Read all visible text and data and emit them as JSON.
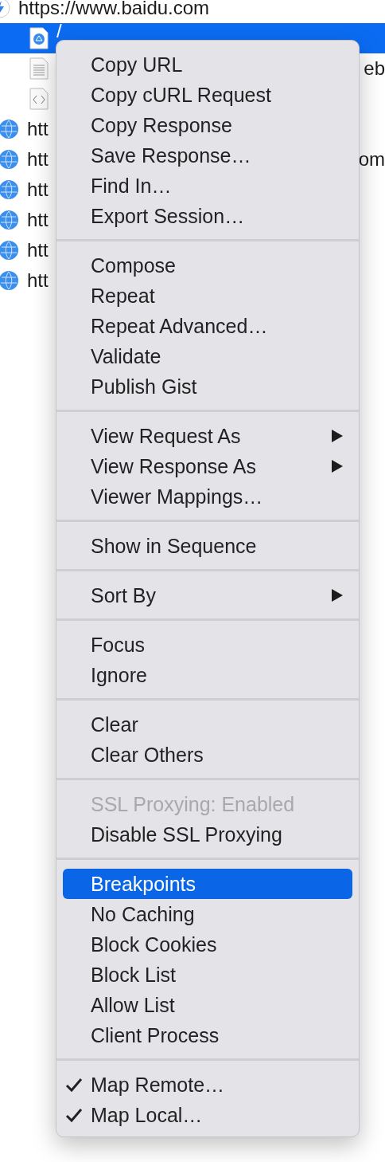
{
  "tree": [
    {
      "kind": "host",
      "label": "https://www.baidu.com",
      "selected": false,
      "children": [
        {
          "kind": "page",
          "label": "/",
          "selected": true
        },
        {
          "kind": "document",
          "trailing": "eb",
          "selected": false
        },
        {
          "kind": "code",
          "selected": false
        }
      ]
    },
    {
      "kind": "globe",
      "label": "htt",
      "selected": false
    },
    {
      "kind": "globe",
      "label": "htt",
      "trailing": "om",
      "selected": false
    },
    {
      "kind": "globe",
      "label": "htt",
      "selected": false
    },
    {
      "kind": "globe",
      "label": "htt",
      "selected": false
    },
    {
      "kind": "globe",
      "label": "htt",
      "selected": false
    },
    {
      "kind": "globe",
      "label": "htt",
      "selected": false
    }
  ],
  "context_menu": {
    "groups": [
      {
        "items": [
          {
            "label": "Copy URL",
            "selected": false,
            "disabled": false,
            "checked": false,
            "submenu": false
          },
          {
            "label": "Copy cURL Request",
            "selected": false,
            "disabled": false,
            "checked": false,
            "submenu": false
          },
          {
            "label": "Copy Response",
            "selected": false,
            "disabled": false,
            "checked": false,
            "submenu": false
          },
          {
            "label": "Save Response…",
            "selected": false,
            "disabled": false,
            "checked": false,
            "submenu": false
          },
          {
            "label": "Find In…",
            "selected": false,
            "disabled": false,
            "checked": false,
            "submenu": false
          },
          {
            "label": "Export Session…",
            "selected": false,
            "disabled": false,
            "checked": false,
            "submenu": false
          }
        ]
      },
      {
        "items": [
          {
            "label": "Compose",
            "selected": false,
            "disabled": false,
            "checked": false,
            "submenu": false
          },
          {
            "label": "Repeat",
            "selected": false,
            "disabled": false,
            "checked": false,
            "submenu": false
          },
          {
            "label": "Repeat Advanced…",
            "selected": false,
            "disabled": false,
            "checked": false,
            "submenu": false
          },
          {
            "label": "Validate",
            "selected": false,
            "disabled": false,
            "checked": false,
            "submenu": false
          },
          {
            "label": "Publish Gist",
            "selected": false,
            "disabled": false,
            "checked": false,
            "submenu": false
          }
        ]
      },
      {
        "items": [
          {
            "label": "View Request As",
            "selected": false,
            "disabled": false,
            "checked": false,
            "submenu": true
          },
          {
            "label": "View Response As",
            "selected": false,
            "disabled": false,
            "checked": false,
            "submenu": true
          },
          {
            "label": "Viewer Mappings…",
            "selected": false,
            "disabled": false,
            "checked": false,
            "submenu": false
          }
        ]
      },
      {
        "items": [
          {
            "label": "Show in Sequence",
            "selected": false,
            "disabled": false,
            "checked": false,
            "submenu": false
          }
        ]
      },
      {
        "items": [
          {
            "label": "Sort By",
            "selected": false,
            "disabled": false,
            "checked": false,
            "submenu": true
          }
        ]
      },
      {
        "items": [
          {
            "label": "Focus",
            "selected": false,
            "disabled": false,
            "checked": false,
            "submenu": false
          },
          {
            "label": "Ignore",
            "selected": false,
            "disabled": false,
            "checked": false,
            "submenu": false
          }
        ]
      },
      {
        "items": [
          {
            "label": "Clear",
            "selected": false,
            "disabled": false,
            "checked": false,
            "submenu": false
          },
          {
            "label": "Clear Others",
            "selected": false,
            "disabled": false,
            "checked": false,
            "submenu": false
          }
        ]
      },
      {
        "items": [
          {
            "label": "SSL Proxying: Enabled",
            "selected": false,
            "disabled": true,
            "checked": false,
            "submenu": false
          },
          {
            "label": "Disable SSL Proxying",
            "selected": false,
            "disabled": false,
            "checked": false,
            "submenu": false
          }
        ]
      },
      {
        "items": [
          {
            "label": "Breakpoints",
            "selected": true,
            "disabled": false,
            "checked": false,
            "submenu": false
          },
          {
            "label": "No Caching",
            "selected": false,
            "disabled": false,
            "checked": false,
            "submenu": false
          },
          {
            "label": "Block Cookies",
            "selected": false,
            "disabled": false,
            "checked": false,
            "submenu": false
          },
          {
            "label": "Block List",
            "selected": false,
            "disabled": false,
            "checked": false,
            "submenu": false
          },
          {
            "label": "Allow List",
            "selected": false,
            "disabled": false,
            "checked": false,
            "submenu": false
          },
          {
            "label": "Client Process",
            "selected": false,
            "disabled": false,
            "checked": false,
            "submenu": false
          }
        ]
      },
      {
        "items": [
          {
            "label": "Map Remote…",
            "selected": false,
            "disabled": false,
            "checked": true,
            "submenu": false
          },
          {
            "label": "Map Local…",
            "selected": false,
            "disabled": false,
            "checked": true,
            "submenu": false
          }
        ]
      }
    ]
  }
}
